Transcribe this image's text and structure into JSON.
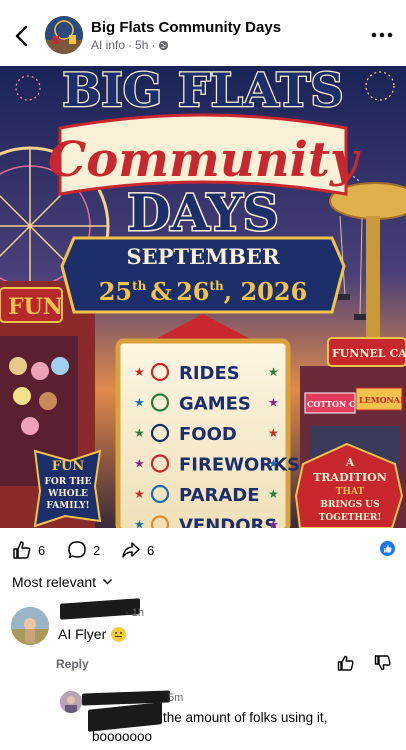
{
  "post": {
    "page_name": "Big Flats Community Days",
    "ai_info": "AI info",
    "separator": "·",
    "time": "5h",
    "separator2": "·"
  },
  "poster": {
    "line1": "BIG FLATS",
    "line2": "Community",
    "line3": "DAYS",
    "date_month": "SEPTEMBER",
    "date_d1": "25",
    "date_sup1": "th",
    "date_amp": "&",
    "date_d2": "26",
    "date_sup2": "th",
    "date_year": ", 2026",
    "left_sign": "FUN",
    "funnel_sign": "FUNNEL CAKES",
    "cotton_sign": "COTTON CANDY",
    "lemon_sign": "LEMONADE",
    "activities": [
      "RIDES",
      "GAMES",
      "FOOD",
      "FIREWORKS",
      "PARADE",
      "VENDORS"
    ],
    "left_badge": [
      "FUN",
      "FOR THE",
      "WHOLE",
      "FAMILY!"
    ],
    "right_badge": [
      "A",
      "TRADITION",
      "THAT",
      "BRINGS US",
      "TOGETHER!"
    ]
  },
  "reactions": {
    "likes": "6",
    "comments": "2",
    "shares": "6"
  },
  "comments": {
    "sort_label": "Most relevant",
    "first": {
      "time": "1h",
      "time_sep": "·",
      "text": "AI Flyer",
      "reply_label": "Reply"
    },
    "reply": {
      "time": "5m",
      "line1": "the amount of folks using it,",
      "line2": "booooooo"
    }
  },
  "colors": {
    "navy": "#1d2f6b",
    "red": "#c8272d",
    "gold": "#f2c34a",
    "cream": "#fbf1d6",
    "fb_blue": "#1877f2",
    "grey": "#65676b"
  },
  "icons": [
    "back-arrow-icon",
    "globe-icon",
    "more-icon",
    "like-icon",
    "comment-icon",
    "share-icon",
    "chevron-down-icon",
    "thumbs-up-icon",
    "thumbs-down-icon"
  ]
}
